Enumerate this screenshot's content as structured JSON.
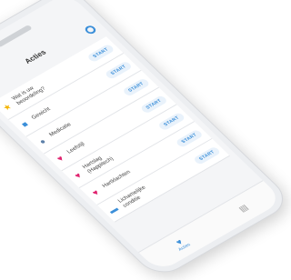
{
  "header": {
    "title": "Acties"
  },
  "actions": [
    {
      "icon": "star-icon",
      "glyph": "★",
      "color": "#f4b400",
      "label": "Wat is uw\nbeoordeling?",
      "button": "START"
    },
    {
      "icon": "scale-icon",
      "glyph": "■",
      "color": "#3b8fd9",
      "label": "Gewicht",
      "button": "START"
    },
    {
      "icon": "pill-icon",
      "glyph": "●",
      "color": "#5c7fa8",
      "label": "Medicatie",
      "button": "START"
    },
    {
      "icon": "heart-icon",
      "glyph": "♥",
      "color": "#e0226e",
      "label": "Leefstijl",
      "button": "START"
    },
    {
      "icon": "heart-icon",
      "glyph": "♥",
      "color": "#e0226e",
      "label": "Hartslag\n(Happitech)",
      "button": "START"
    },
    {
      "icon": "broken-heart-icon",
      "glyph": "♥",
      "color": "#e0226e",
      "label": "Hartklachten",
      "button": "START"
    },
    {
      "icon": "thermometer-icon",
      "glyph": "▬",
      "color": "#3b8fd9",
      "label": "Lichamelijke\nconditie",
      "button": "START"
    }
  ],
  "tabbar": {
    "active_label": "Acties"
  },
  "colors": {
    "accent": "#3b8fd9",
    "heart": "#e0226e",
    "star": "#f4b400"
  }
}
